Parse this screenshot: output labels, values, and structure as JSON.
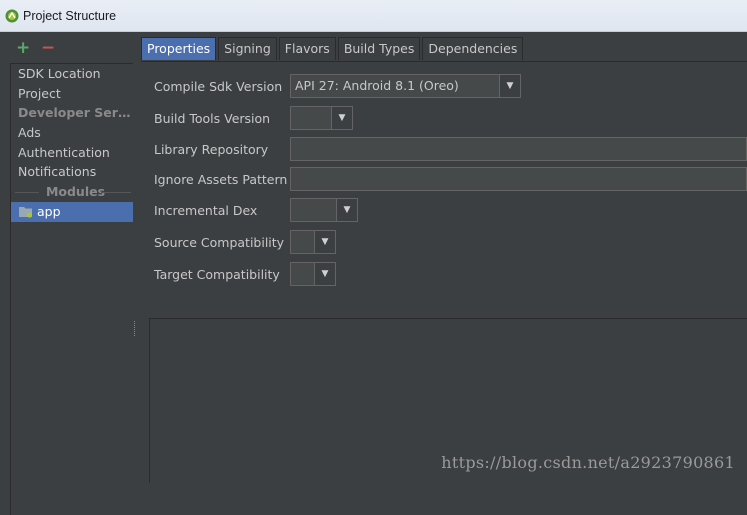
{
  "window": {
    "title": "Project Structure"
  },
  "toolbar": {
    "add_symbol": "+",
    "remove_symbol": "−"
  },
  "sidebar": {
    "items": [
      {
        "label": "SDK Location",
        "kind": "item"
      },
      {
        "label": "Project",
        "kind": "item"
      },
      {
        "label": "Developer Servic...",
        "kind": "header"
      },
      {
        "label": "Ads",
        "kind": "item"
      },
      {
        "label": "Authentication",
        "kind": "item"
      },
      {
        "label": "Notifications",
        "kind": "item"
      },
      {
        "label": "Modules",
        "kind": "group"
      },
      {
        "label": "app",
        "kind": "item",
        "selected": true
      }
    ]
  },
  "tabs": [
    {
      "label": "Properties",
      "active": true
    },
    {
      "label": "Signing"
    },
    {
      "label": "Flavors"
    },
    {
      "label": "Build Types"
    },
    {
      "label": "Dependencies"
    }
  ],
  "properties": {
    "compile_sdk": {
      "label": "Compile Sdk Version",
      "value": "API 27: Android 8.1 (Oreo)"
    },
    "build_tools": {
      "label": "Build Tools Version",
      "value": ""
    },
    "library_repo": {
      "label": "Library Repository",
      "value": ""
    },
    "ignore_assets": {
      "label": "Ignore Assets Pattern",
      "value": ""
    },
    "incremental_dex": {
      "label": "Incremental Dex",
      "value": ""
    },
    "source_compat": {
      "label": "Source Compatibility",
      "value": ""
    },
    "target_compat": {
      "label": "Target Compatibility",
      "value": ""
    }
  },
  "watermark": "https://blog.csdn.net/a2923790861",
  "colors": {
    "accent": "#4b6eaf",
    "background": "#3c3f41",
    "add": "#59a869",
    "remove": "#c75450"
  }
}
